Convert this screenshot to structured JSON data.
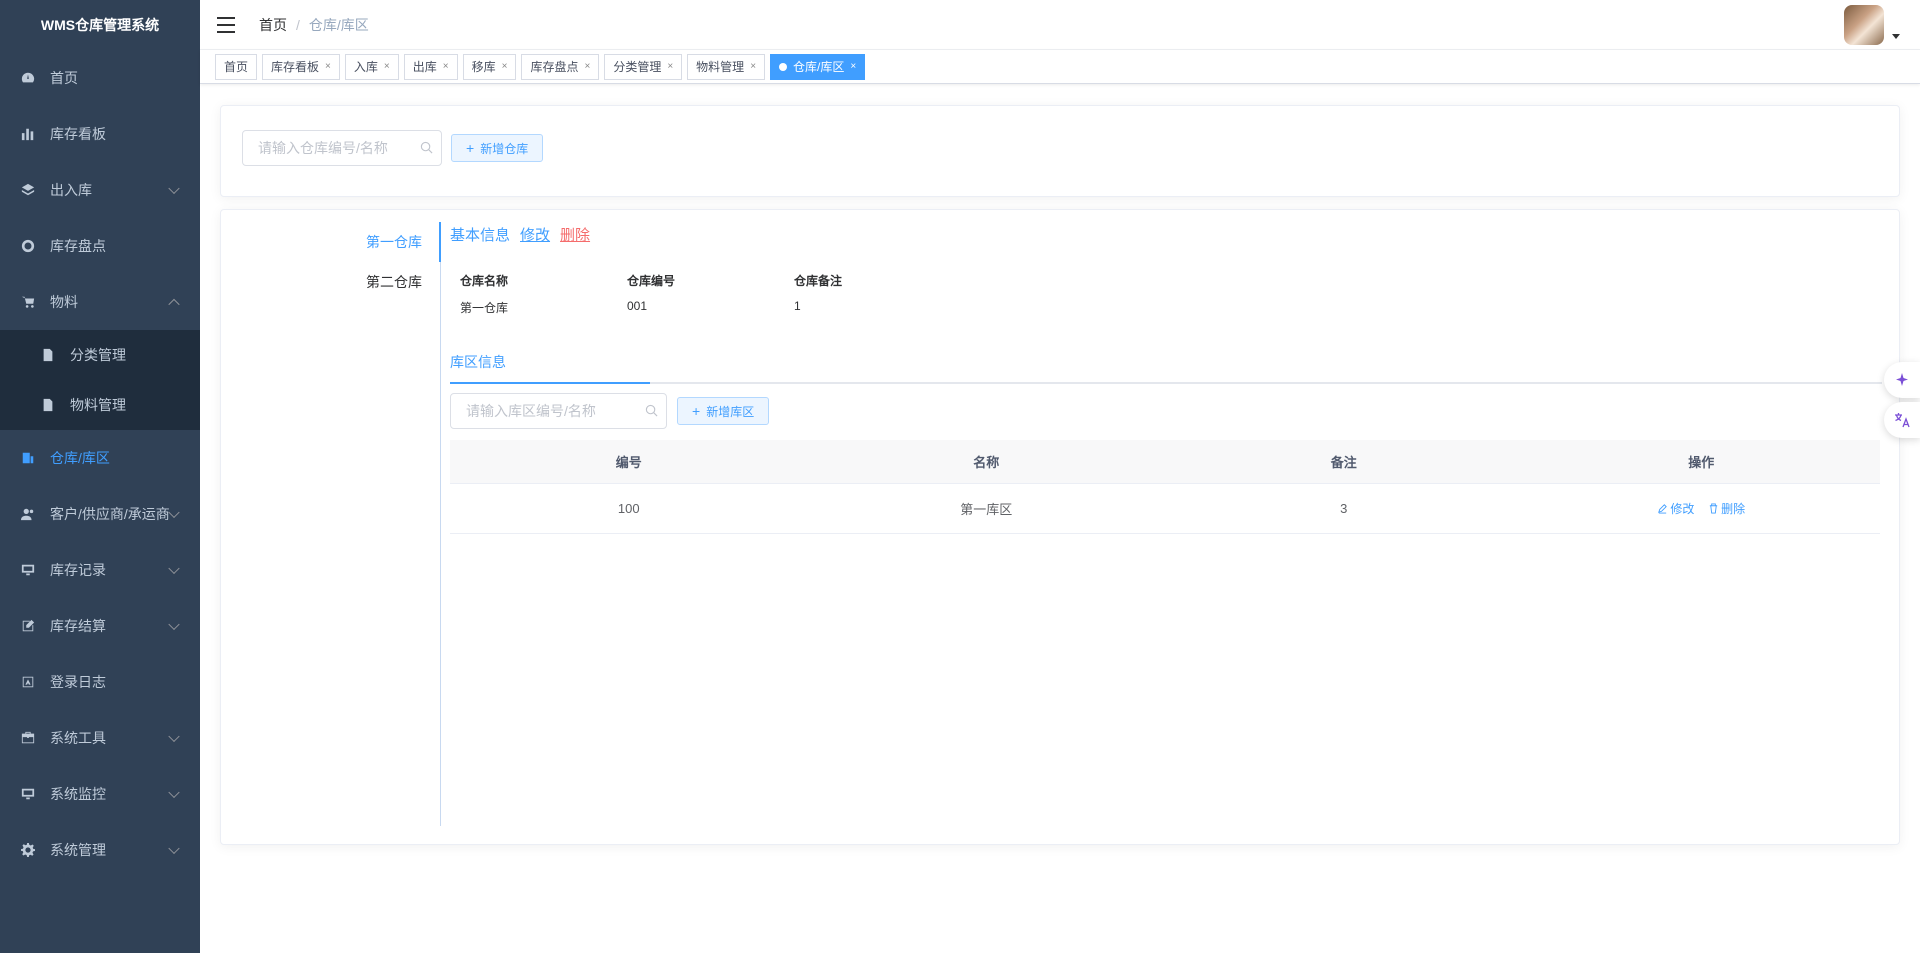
{
  "app": {
    "title": "WMS仓库管理系统"
  },
  "sidebar": {
    "items": [
      {
        "label": "首页",
        "icon": "dashboard-icon"
      },
      {
        "label": "库存看板",
        "icon": "bar-chart-icon"
      },
      {
        "label": "出入库",
        "icon": "layers-icon"
      },
      {
        "label": "库存盘点",
        "icon": "target-icon"
      },
      {
        "label": "物料",
        "icon": "cart-icon"
      },
      {
        "label": "分类管理",
        "icon": "document-icon"
      },
      {
        "label": "物料管理",
        "icon": "document-icon"
      },
      {
        "label": "仓库/库区",
        "icon": "warehouse-icon"
      },
      {
        "label": "客户/供应商/承运商",
        "icon": "users-icon"
      },
      {
        "label": "库存记录",
        "icon": "monitor-icon"
      },
      {
        "label": "库存结算",
        "icon": "edit-icon"
      },
      {
        "label": "登录日志",
        "icon": "log-icon"
      },
      {
        "label": "系统工具",
        "icon": "toolbox-icon"
      },
      {
        "label": "系统监控",
        "icon": "monitor-icon"
      },
      {
        "label": "系统管理",
        "icon": "gear-icon"
      }
    ]
  },
  "navbar": {
    "breadcrumb": [
      "首页",
      "仓库/库区"
    ]
  },
  "tags": [
    {
      "label": "首页"
    },
    {
      "label": "库存看板"
    },
    {
      "label": "入库"
    },
    {
      "label": "出库"
    },
    {
      "label": "移库"
    },
    {
      "label": "库存盘点"
    },
    {
      "label": "分类管理"
    },
    {
      "label": "物料管理"
    },
    {
      "label": "仓库/库区"
    }
  ],
  "search": {
    "placeholder": "请输入仓库编号/名称",
    "add_button": "新增仓库"
  },
  "warehouses": [
    "第一仓库",
    "第二仓库"
  ],
  "info": {
    "title": "基本信息",
    "edit": "修改",
    "delete": "删除",
    "fields": [
      {
        "label": "仓库名称",
        "value": "第一仓库"
      },
      {
        "label": "仓库编号",
        "value": "001"
      },
      {
        "label": "仓库备注",
        "value": "1"
      }
    ]
  },
  "area": {
    "tab": "库区信息",
    "placeholder": "请输入库区编号/名称",
    "add_button": "新增库区",
    "columns": [
      "编号",
      "名称",
      "备注",
      "操作"
    ],
    "rows": [
      {
        "code": "100",
        "name": "第一库区",
        "remark": "3",
        "edit": "修改",
        "delete": "删除"
      }
    ]
  },
  "colors": {
    "sidebar_bg": "#304156",
    "accent": "#409eff",
    "danger": "#f56c6c"
  }
}
